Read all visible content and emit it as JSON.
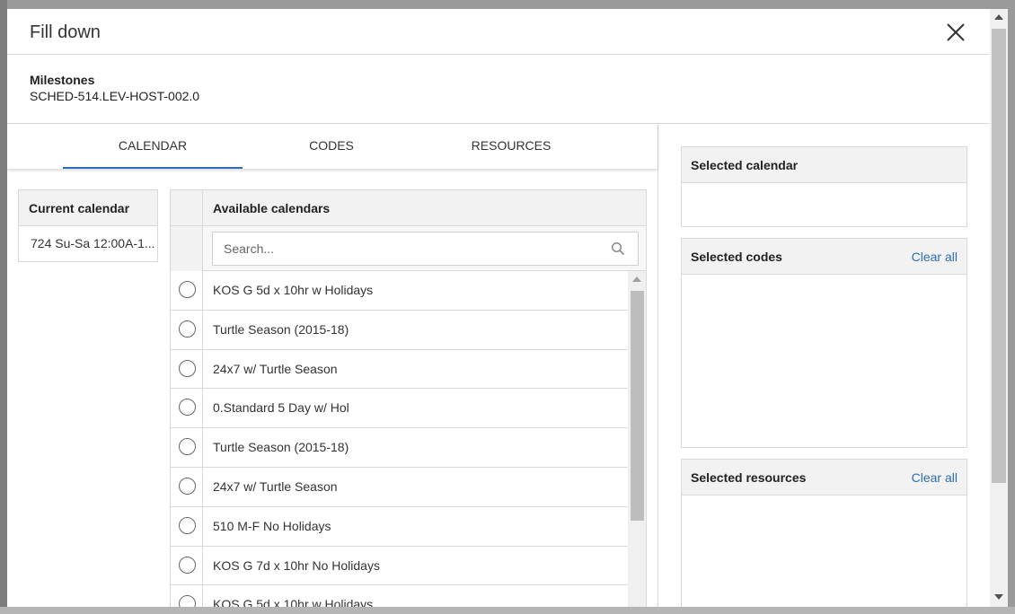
{
  "dialog": {
    "title": "Fill down",
    "close_icon": "close-icon"
  },
  "info": {
    "label": "Milestones",
    "value": "SCHED-514.LEV-HOST-002.0"
  },
  "tabs": [
    {
      "label": "CALENDAR",
      "active": true
    },
    {
      "label": "CODES",
      "active": false
    },
    {
      "label": "RESOURCES",
      "active": false
    }
  ],
  "current_calendar": {
    "header": "Current calendar",
    "value": "724 Su-Sa 12:00A-1..."
  },
  "available_calendars": {
    "header": "Available calendars",
    "search_placeholder": "Search...",
    "search_icon": "search-icon",
    "items": [
      {
        "label": "KOS G 5d x 10hr w Holidays"
      },
      {
        "label": "Turtle Season (2015-18)"
      },
      {
        "label": "24x7 w/ Turtle Season"
      },
      {
        "label": "0.Standard 5 Day w/ Hol"
      },
      {
        "label": "Turtle Season (2015-18)"
      },
      {
        "label": "24x7 w/ Turtle Season"
      },
      {
        "label": "510 M-F No Holidays"
      },
      {
        "label": "KOS G 7d x 10hr No Holidays"
      },
      {
        "label": "KOS G 5d x 10hr w Holidays"
      }
    ]
  },
  "right_panels": {
    "selected_calendar": {
      "title": "Selected calendar"
    },
    "selected_codes": {
      "title": "Selected codes",
      "action": "Clear all"
    },
    "selected_resources": {
      "title": "Selected resources",
      "action": "Clear all"
    }
  },
  "colors": {
    "accent": "#2d6db5",
    "header_bg": "#f2f2f2",
    "border": "#d9d9d9"
  }
}
